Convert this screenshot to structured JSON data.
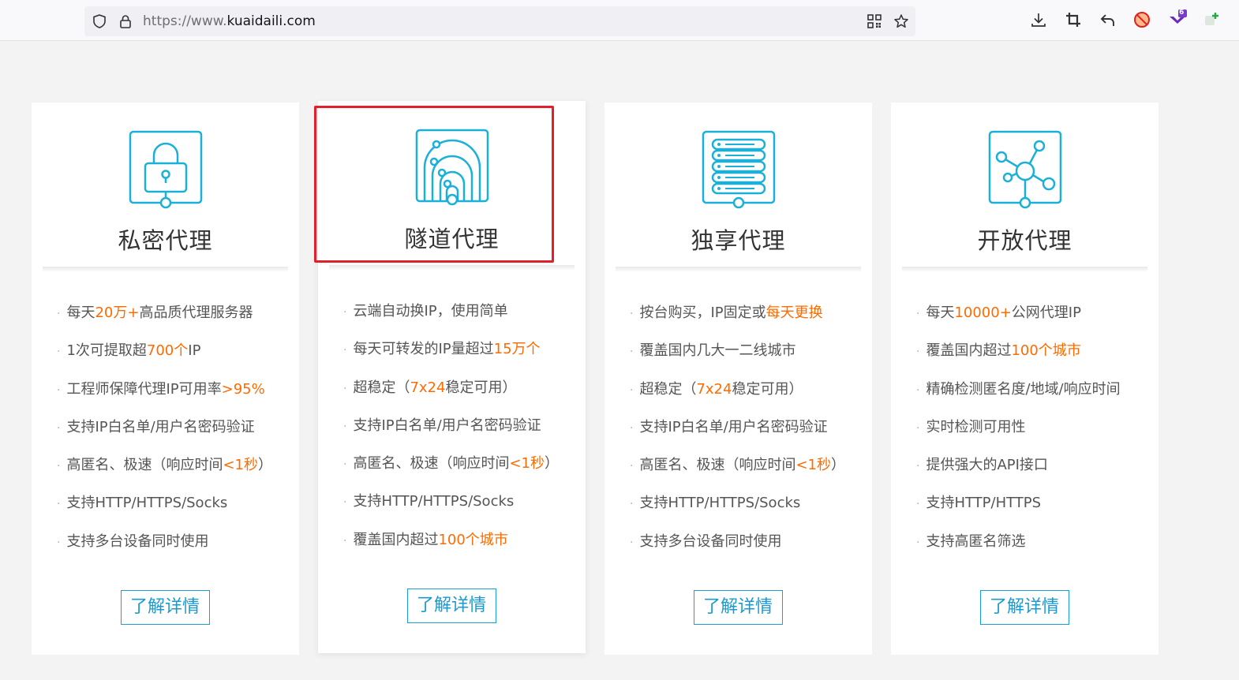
{
  "browser": {
    "url_prefix": "https://www.",
    "url_domain": "kuaidaili.com",
    "extension_badge": "6",
    "icons": [
      "shield-icon",
      "lock-icon",
      "qr-code-icon",
      "star-icon",
      "download-icon",
      "crop-icon",
      "back-arrow-icon",
      "blocked-icon",
      "extension-icon",
      "add-extension-icon"
    ]
  },
  "colors": {
    "accent": "#1a9ad0",
    "highlight": "#ff6b00",
    "selection_box": "#e0202a"
  },
  "cards": [
    {
      "title": "私密代理",
      "icon": "padlock-icon",
      "features": [
        {
          "pre": "每天",
          "hl": "20万+",
          "post": "高品质代理服务器"
        },
        {
          "pre": "1次可提取超",
          "hl": "700个",
          "post": "IP"
        },
        {
          "pre": "工程师保障代理IP可用率",
          "hl": ">95%",
          "post": ""
        },
        {
          "pre": "支持IP白名单/用户名密码验证",
          "hl": "",
          "post": ""
        },
        {
          "pre": "高匿名、极速（响应时间",
          "hl": "<1秒",
          "post": "）"
        },
        {
          "pre": "支持HTTP/HTTPS/Socks",
          "hl": "",
          "post": ""
        },
        {
          "pre": "支持多台设备同时使用",
          "hl": "",
          "post": ""
        }
      ],
      "button": "了解详情"
    },
    {
      "title": "隧道代理",
      "icon": "tunnel-icon",
      "features": [
        {
          "pre": "云端自动换IP，使用简单",
          "hl": "",
          "post": ""
        },
        {
          "pre": "每天可转发的IP量超过",
          "hl": "15万个",
          "post": ""
        },
        {
          "pre": "超稳定（",
          "hl": "7x24",
          "post": "稳定可用）"
        },
        {
          "pre": "支持IP白名单/用户名密码验证",
          "hl": "",
          "post": ""
        },
        {
          "pre": "高匿名、极速（响应时间",
          "hl": "<1秒",
          "post": "）"
        },
        {
          "pre": "支持HTTP/HTTPS/Socks",
          "hl": "",
          "post": ""
        },
        {
          "pre": "覆盖国内超过",
          "hl": "100个城市",
          "post": ""
        }
      ],
      "button": "了解详情"
    },
    {
      "title": "独享代理",
      "icon": "server-icon",
      "features": [
        {
          "pre": "按台购买，IP固定或",
          "hl": "每天更换",
          "post": ""
        },
        {
          "pre": "覆盖国内几大一二线城市",
          "hl": "",
          "post": ""
        },
        {
          "pre": "超稳定（",
          "hl": "7x24",
          "post": "稳定可用）"
        },
        {
          "pre": "支持IP白名单/用户名密码验证",
          "hl": "",
          "post": ""
        },
        {
          "pre": "高匿名、极速（响应时间",
          "hl": "<1秒",
          "post": "）"
        },
        {
          "pre": "支持HTTP/HTTPS/Socks",
          "hl": "",
          "post": ""
        },
        {
          "pre": "支持多台设备同时使用",
          "hl": "",
          "post": ""
        }
      ],
      "button": "了解详情"
    },
    {
      "title": "开放代理",
      "icon": "network-nodes-icon",
      "features": [
        {
          "pre": "每天",
          "hl": "10000+",
          "post": "公网代理IP"
        },
        {
          "pre": "覆盖国内超过",
          "hl": "100个城市",
          "post": ""
        },
        {
          "pre": "精确检测匿名度/地域/响应时间",
          "hl": "",
          "post": ""
        },
        {
          "pre": "实时检测可用性",
          "hl": "",
          "post": ""
        },
        {
          "pre": "提供强大的API接口",
          "hl": "",
          "post": ""
        },
        {
          "pre": "支持HTTP/HTTPS",
          "hl": "",
          "post": ""
        },
        {
          "pre": "支持高匿名筛选",
          "hl": "",
          "post": ""
        }
      ],
      "button": "了解详情"
    }
  ]
}
